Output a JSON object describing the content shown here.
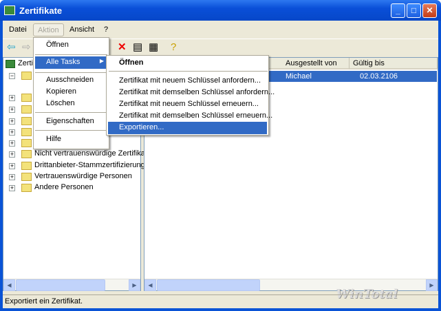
{
  "window": {
    "title": "Zertifikate",
    "minimize": "_",
    "maximize": "□",
    "close": "✕"
  },
  "menubar": [
    "Datei",
    "Aktion",
    "Ansicht",
    "?"
  ],
  "toolbar_icons": [
    "back-icon",
    "forward-icon",
    "delete-icon",
    "properties-icon",
    "export-icon",
    "help-icon"
  ],
  "tree": {
    "root": "Zertifikate",
    "items": [
      "Nicht vertrauenswürdige Zertifikate",
      "Drittanbieter-Stammzertifizierungsstellen",
      "Vertrauenswürdige Personen",
      "Andere Personen"
    ]
  },
  "list": {
    "columns": [
      "Ausgestellt von",
      "Gültig bis"
    ],
    "rows": [
      {
        "issuer": "Michael",
        "valid": "02.03.2106"
      }
    ]
  },
  "aktion_menu": {
    "items": [
      "Öffnen",
      "Alle Tasks",
      "Ausschneiden",
      "Kopieren",
      "Löschen",
      "Eigenschaften",
      "Hilfe"
    ]
  },
  "tasks_menu": {
    "items": [
      "Öffnen",
      "Zertifikat mit neuem Schlüssel anfordern...",
      "Zertifikat mit demselben Schlüssel anfordern...",
      "Zertifikat mit neuem Schlüssel erneuern...",
      "Zertifikat mit demselben Schlüssel erneuern...",
      "Exportieren..."
    ]
  },
  "status": "Exportiert ein Zertifikat.",
  "watermark": "WinTotal"
}
